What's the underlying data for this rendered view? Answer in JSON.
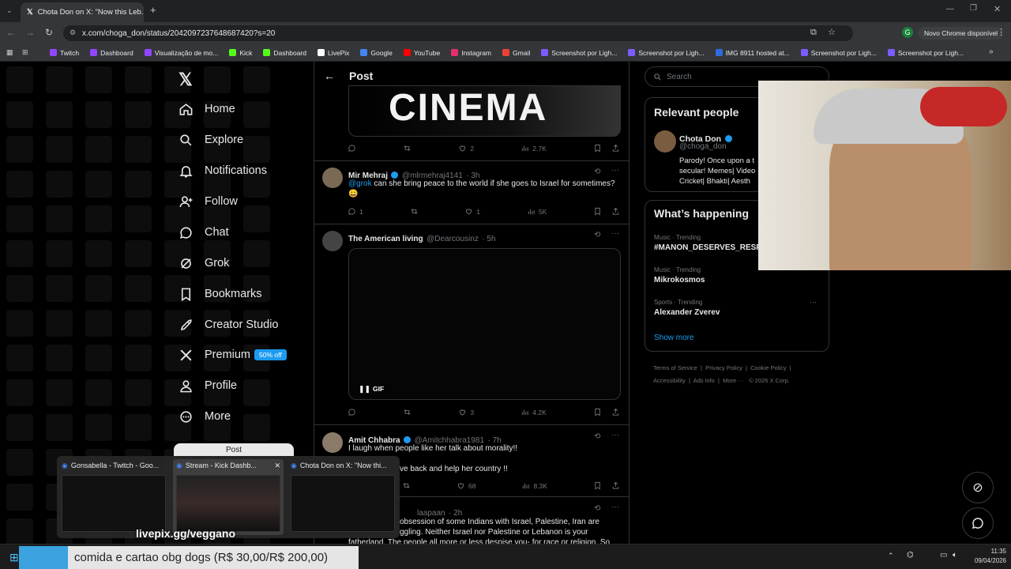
{
  "browser": {
    "tab_title": "Chota Don on X: \"Now this Leb...",
    "new_tab": "+",
    "url": "x.com/choga_don/status/2042097237648687420?s=20",
    "update_button": "Novo Chrome disponível",
    "profile_letter": "G"
  },
  "bookmarks": [
    {
      "label": "Twitch",
      "color": "#9146ff"
    },
    {
      "label": "Dashboard",
      "color": "#9146ff"
    },
    {
      "label": "Visualização de mo...",
      "color": "#9146ff"
    },
    {
      "label": "Kick",
      "color": "#53fc18"
    },
    {
      "label": "Dashboard",
      "color": "#53fc18"
    },
    {
      "label": "LivePix",
      "color": "#ffffff"
    },
    {
      "label": "Google",
      "color": "#4285f4"
    },
    {
      "label": "YouTube",
      "color": "#ff0000"
    },
    {
      "label": "Instagram",
      "color": "#e1306c"
    },
    {
      "label": "Gmail",
      "color": "#ea4335"
    },
    {
      "label": "Screenshot por Ligh...",
      "color": "#7b5cff"
    },
    {
      "label": "Screenshot por Ligh...",
      "color": "#7b5cff"
    },
    {
      "label": "IMG 8911 hosted at...",
      "color": "#2d6cdf"
    },
    {
      "label": "Screenshot por Ligh...",
      "color": "#7b5cff"
    },
    {
      "label": "Screenshot por Ligh...",
      "color": "#7b5cff"
    }
  ],
  "nav": {
    "items": [
      {
        "label": "Home",
        "icon": "home-icon"
      },
      {
        "label": "Explore",
        "icon": "search-icon"
      },
      {
        "label": "Notifications",
        "icon": "bell-icon"
      },
      {
        "label": "Follow",
        "icon": "person-plus-icon"
      },
      {
        "label": "Chat",
        "icon": "chat-icon"
      },
      {
        "label": "Grok",
        "icon": "grok-icon"
      },
      {
        "label": "Bookmarks",
        "icon": "bookmark-icon"
      },
      {
        "label": "Creator Studio",
        "icon": "rocket-icon"
      },
      {
        "label": "Premium",
        "icon": "x-icon"
      },
      {
        "label": "Profile",
        "icon": "person-icon"
      },
      {
        "label": "More",
        "icon": "more-icon"
      }
    ],
    "premium_badge": "50% off"
  },
  "post_header": {
    "title": "Post"
  },
  "top_media_text": "CINEMA",
  "top_actions": {
    "likes": "2",
    "views": "2.7K"
  },
  "tweets": [
    {
      "name": "Mir Mehraj",
      "handle": "@mlrmehraj4141",
      "time": "· 3h",
      "mention": "@grok",
      "text": " can she bring peace to the world if she goes to Israel for sometimes?",
      "emoji": "😀",
      "replies": "1",
      "reposts": "",
      "likes": "1",
      "views": "5K"
    },
    {
      "name": "The American living",
      "handle": "@Dearcousinz",
      "time": "· 5h",
      "media_label": "GIF",
      "replies": "",
      "reposts": "",
      "likes": "3",
      "views": "4.2K"
    },
    {
      "name": "Amit Chhabra",
      "handle": "@Amitchhabra1981",
      "time": "· 7h",
      "text": "I laugh when people like her talk about morality!!",
      "text2": "ve back and help her country !!",
      "replies": "",
      "reposts": "",
      "likes": "68",
      "views": "8.3K"
    },
    {
      "handle": "laapaan",
      "time": "· 2h",
      "text": "obsession of some Indians with Israel, Palestine, Iran are",
      "text2": "ggling. Neither Israel nor Palestine or Lebanon is your",
      "text3": "fatherland. The people all more or less despise you- for race or religion. So"
    }
  ],
  "search": {
    "placeholder": "Search"
  },
  "relevant": {
    "title": "Relevant people",
    "name": "Chota Don",
    "handle": "@choga_don",
    "bio": "Parody! Once upon a t secular! Memes| Video Cricket| Bhakti| Aesth"
  },
  "happening": {
    "title": "What’s happening",
    "trends": [
      {
        "category": "Music · Trending",
        "name": "#MANON_DESERVES_RESP"
      },
      {
        "category": "Music · Trending",
        "name": "Mikrokosmos"
      },
      {
        "category": "Sports · Trending",
        "name": "Alexander Zverev"
      }
    ],
    "show_more": "Show more"
  },
  "footer": {
    "links": [
      "Terms of Service",
      "Privacy Policy",
      "Cookie Policy",
      "Accessibility",
      "Ads info",
      "More ···",
      "© 2026 X Corp."
    ]
  },
  "thumbnails": [
    {
      "title": "Gonsabella - Twitch - Goo..."
    },
    {
      "title": "Stream - Kick Dashb..."
    },
    {
      "title": "Chota Don on X: \"Now thi..."
    }
  ],
  "overlay": {
    "livepix": "livepix.gg/veggano",
    "donation": "comida e cartao obg dogs (R$ 30,00/R$ 200,00)",
    "partial_button": "Post"
  },
  "taskbar": {
    "time": "11:35",
    "date": "09/04/2026"
  },
  "colors": {
    "accent": "#1d9bf0",
    "bg": "#000000",
    "border": "#2f3336",
    "muted": "#71767b"
  }
}
